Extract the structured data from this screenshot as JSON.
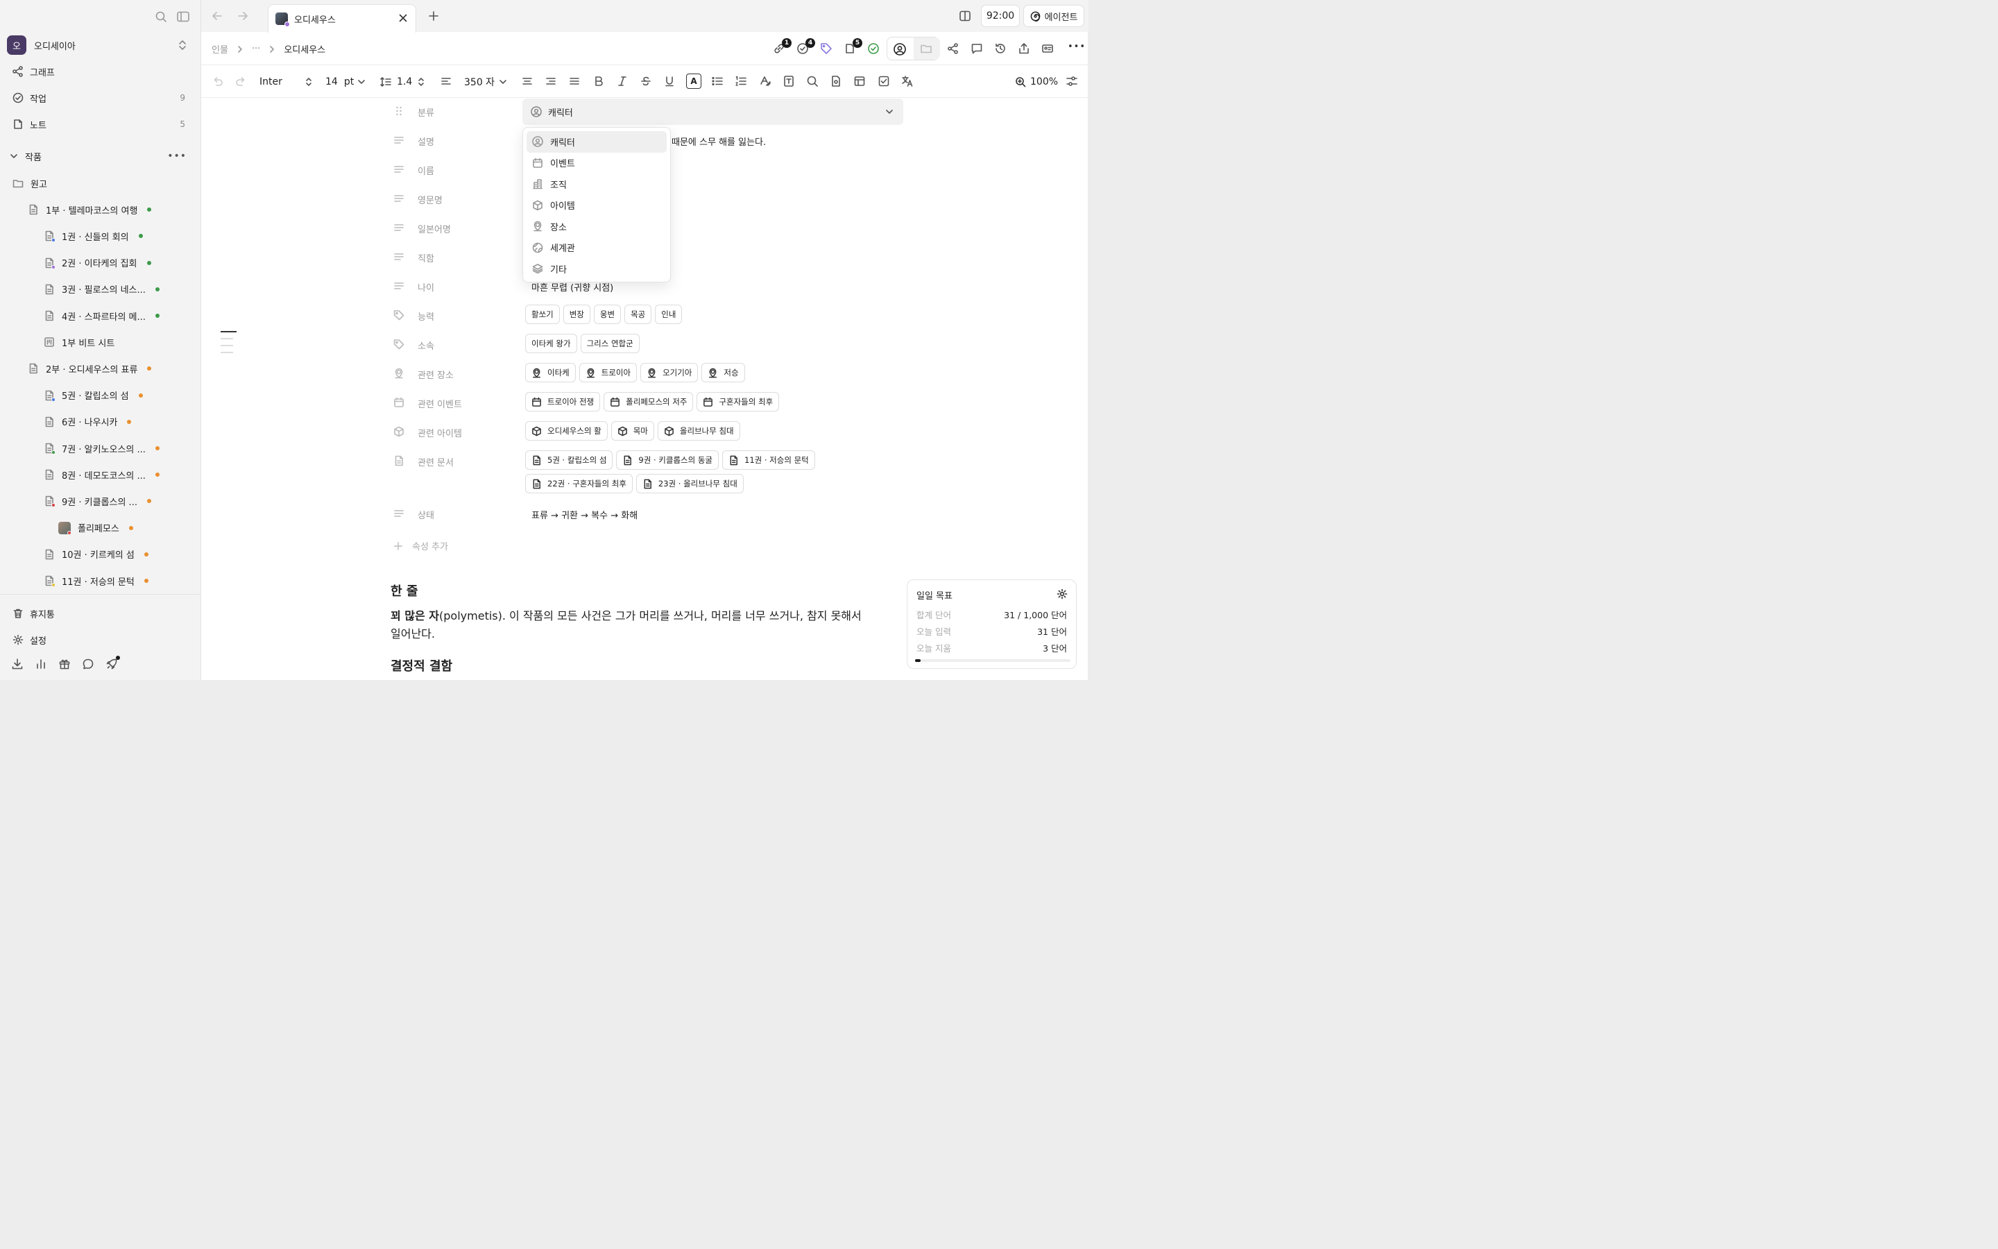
{
  "sidebar": {
    "workspace": {
      "initial": "오",
      "name": "오디세이아",
      "color": "#4a3a66"
    },
    "nav": [
      {
        "label": "그래프",
        "count": ""
      },
      {
        "label": "작업",
        "count": "9"
      },
      {
        "label": "노트",
        "count": "5"
      }
    ],
    "section": {
      "title": "작품"
    },
    "tree": [
      {
        "label": "원고",
        "kind": "folder",
        "depth": 0,
        "dot": ""
      },
      {
        "label": "1부 · 텔레마코스의 여행",
        "kind": "doc",
        "depth": 1,
        "dot": "#3c9a4a",
        "sub": ""
      },
      {
        "label": "1권 · 신들의 회의",
        "kind": "doc",
        "depth": 2,
        "dot": "#3c9a4a",
        "sub": "#4a7ae0"
      },
      {
        "label": "2권 · 이타케의 집회",
        "kind": "doc",
        "depth": 2,
        "dot": "#3c9a4a",
        "sub": "#a071d9"
      },
      {
        "label": "3권 · 필로스의 네스...",
        "kind": "doc",
        "depth": 2,
        "dot": "#3c9a4a",
        "sub": ""
      },
      {
        "label": "4권 · 스파르타의 메...",
        "kind": "doc",
        "depth": 2,
        "dot": "#3c9a4a",
        "sub": ""
      },
      {
        "label": "1부 비트 시트",
        "kind": "sheet",
        "depth": 2,
        "dot": "",
        "sub": ""
      },
      {
        "label": "2부 · 오디세우스의 표류",
        "kind": "doc",
        "depth": 1,
        "dot": "#e9902f",
        "sub": ""
      },
      {
        "label": "5권 · 칼립소의 섬",
        "kind": "doc",
        "depth": 2,
        "dot": "#e9902f",
        "sub": "#4a7ae0"
      },
      {
        "label": "6권 · 나우시카",
        "kind": "doc",
        "depth": 2,
        "dot": "#e9902f",
        "sub": ""
      },
      {
        "label": "7권 · 알키노오스의 ...",
        "kind": "doc",
        "depth": 2,
        "dot": "#e9902f",
        "sub": "#3c9a4a"
      },
      {
        "label": "8권 · 데모도코스의 ...",
        "kind": "doc",
        "depth": 2,
        "dot": "#e9902f",
        "sub": ""
      },
      {
        "label": "9권 · 키클롭스의 ...",
        "kind": "doc",
        "depth": 2,
        "dot": "#e9902f",
        "sub": "#d94343"
      },
      {
        "label": "폴리페모스",
        "kind": "avatar",
        "depth": 3,
        "dot": "#e9902f",
        "sub": "#d94343"
      },
      {
        "label": "10권 · 키르케의 섬",
        "kind": "doc",
        "depth": 2,
        "dot": "#e9902f",
        "sub": ""
      },
      {
        "label": "11권 · 저승의 문턱",
        "kind": "doc",
        "depth": 2,
        "dot": "#e9902f",
        "sub": "#e5c43a"
      }
    ],
    "bottom": [
      {
        "label": "휴지통"
      },
      {
        "label": "설정"
      }
    ]
  },
  "tabbar": {
    "tab_title": "오디세우스",
    "time": "92:00",
    "agent_label": "에이전트"
  },
  "breadcrumb": {
    "root": "인물",
    "ellipsis": "···",
    "current": "오디세우스"
  },
  "header_badges": {
    "links": "1",
    "tasks": "4",
    "docs": "5"
  },
  "toolbar": {
    "font": "Inter",
    "size": "14",
    "unit": "pt",
    "line_height": "1.4",
    "width": "350 자",
    "zoom": "100%"
  },
  "properties": {
    "category": {
      "label": "분류",
      "value": "캐릭터"
    },
    "description": {
      "label": "설명",
      "value_tail": "때문에 스무 해를 잃는다."
    },
    "name": {
      "label": "이름"
    },
    "english_name": {
      "label": "영문명"
    },
    "japanese_name": {
      "label": "일본어명"
    },
    "title": {
      "label": "직함"
    },
    "age": {
      "label": "나이",
      "value": "마흔 무렵 (귀향 시점)"
    },
    "abilities": {
      "label": "능력",
      "chips": [
        "활쏘기",
        "변장",
        "웅변",
        "목공",
        "인내"
      ]
    },
    "affiliation": {
      "label": "소속",
      "chips": [
        "이타케 왕가",
        "그리스 연합군"
      ]
    },
    "places": {
      "label": "관련 장소",
      "chips": [
        "이타케",
        "트로이아",
        "오기기아",
        "저승"
      ]
    },
    "events": {
      "label": "관련 이벤트",
      "chips": [
        "트로이아 전쟁",
        "폴리페모스의 저주",
        "구혼자들의 최후"
      ]
    },
    "items": {
      "label": "관련 아이템",
      "chips": [
        "오디세우스의 활",
        "목마",
        "올리브나무 침대"
      ]
    },
    "documents": {
      "label": "관련 문서",
      "chips_row1": [
        "5권 · 칼립소의 섬",
        "9권 · 키클롭스의 동굴",
        "11권 · 저승의 문턱"
      ],
      "chips_row2": [
        "22권 · 구혼자들의 최후",
        "23권 · 올리브나무 침대"
      ]
    },
    "status": {
      "label": "상태",
      "value": "표류 → 귀환 → 복수 → 화해"
    },
    "add_label": "속성 추가"
  },
  "dropdown": {
    "options": [
      {
        "label": "캐릭터",
        "icon": "person-icon"
      },
      {
        "label": "이벤트",
        "icon": "calendar-icon"
      },
      {
        "label": "조직",
        "icon": "building-icon"
      },
      {
        "label": "아이템",
        "icon": "cube-icon"
      },
      {
        "label": "장소",
        "icon": "pin-icon"
      },
      {
        "label": "세계관",
        "icon": "globe-icon"
      },
      {
        "label": "기타",
        "icon": "layers-icon"
      }
    ]
  },
  "body": {
    "h_oneline": "한 줄",
    "p_bold": "꾀 많은 자",
    "p_rest": "(polymetis). 이 작품의 모든 사건은 그가 머리를 쓰거나, 머리를 너무 쓰거나, 참지 못해서",
    "p_rest2": "일어난다.",
    "h_flaw": "결정적 결함"
  },
  "goal": {
    "title": "일일 목표",
    "rows": [
      {
        "label": "합계 단어",
        "value": "31 / 1,000 단어"
      },
      {
        "label": "오늘 입력",
        "value": "31 단어"
      },
      {
        "label": "오늘 지움",
        "value": "3 단어"
      }
    ],
    "progress": 0.031
  }
}
